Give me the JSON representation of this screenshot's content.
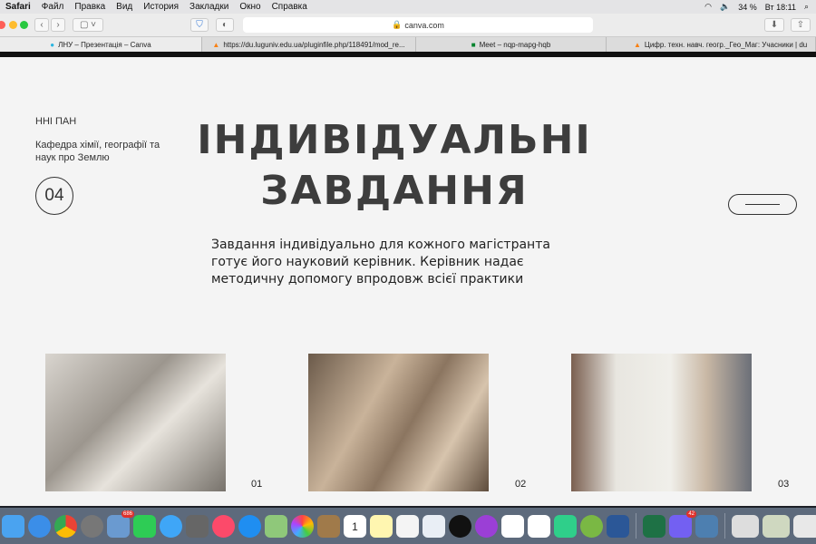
{
  "menubar": {
    "app": "Safari",
    "items": [
      "Файл",
      "Правка",
      "Вид",
      "История",
      "Закладки",
      "Окно",
      "Справка"
    ],
    "battery": "34 %",
    "clock": "Вт 18:11"
  },
  "toolbar": {
    "url": "canva.com"
  },
  "tabs": [
    {
      "label": "ЛНУ – Презентація – Canva",
      "active": true
    },
    {
      "label": "https://du.luguniv.edu.ua/pluginfile.php/118491/mod_re...",
      "active": false
    },
    {
      "label": "Meet – nqp-mapg-hqb",
      "active": false
    },
    {
      "label": "Цифр. техн. навч. геогр._Гео_Маг: Учасники | du",
      "active": false
    }
  ],
  "slide": {
    "org": "ННІ ПАН",
    "department": "Кафедра хімії, географії та наук про Землю",
    "number": "04",
    "title_line1": "ІНДИВІДУАЛЬНІ",
    "title_line2": "ЗАВДАННЯ",
    "description": "Завдання індивідуально для кожного магістранта готує його науковий керівник. Керівник надає методичну допомогу впродовж всієї практики",
    "captions": [
      "01",
      "02",
      "03"
    ]
  },
  "dock": {
    "apps": [
      "finder",
      "safari",
      "chrome",
      "launchpad",
      "preview",
      "facetime",
      "messages",
      "system-preferences",
      "music",
      "app-store",
      "maps",
      "photos",
      "contacts",
      "calendar",
      "notes",
      "reminders",
      "keynote",
      "apple-tv",
      "podcasts",
      "numbers",
      "pages",
      "mindmap",
      "qgis",
      "word",
      "excel",
      "viber",
      "image-capture",
      "window-1",
      "window-2",
      "window-3",
      "trash"
    ],
    "badge_preview": "686",
    "badge_viber": "42",
    "calendar_day": "1"
  }
}
